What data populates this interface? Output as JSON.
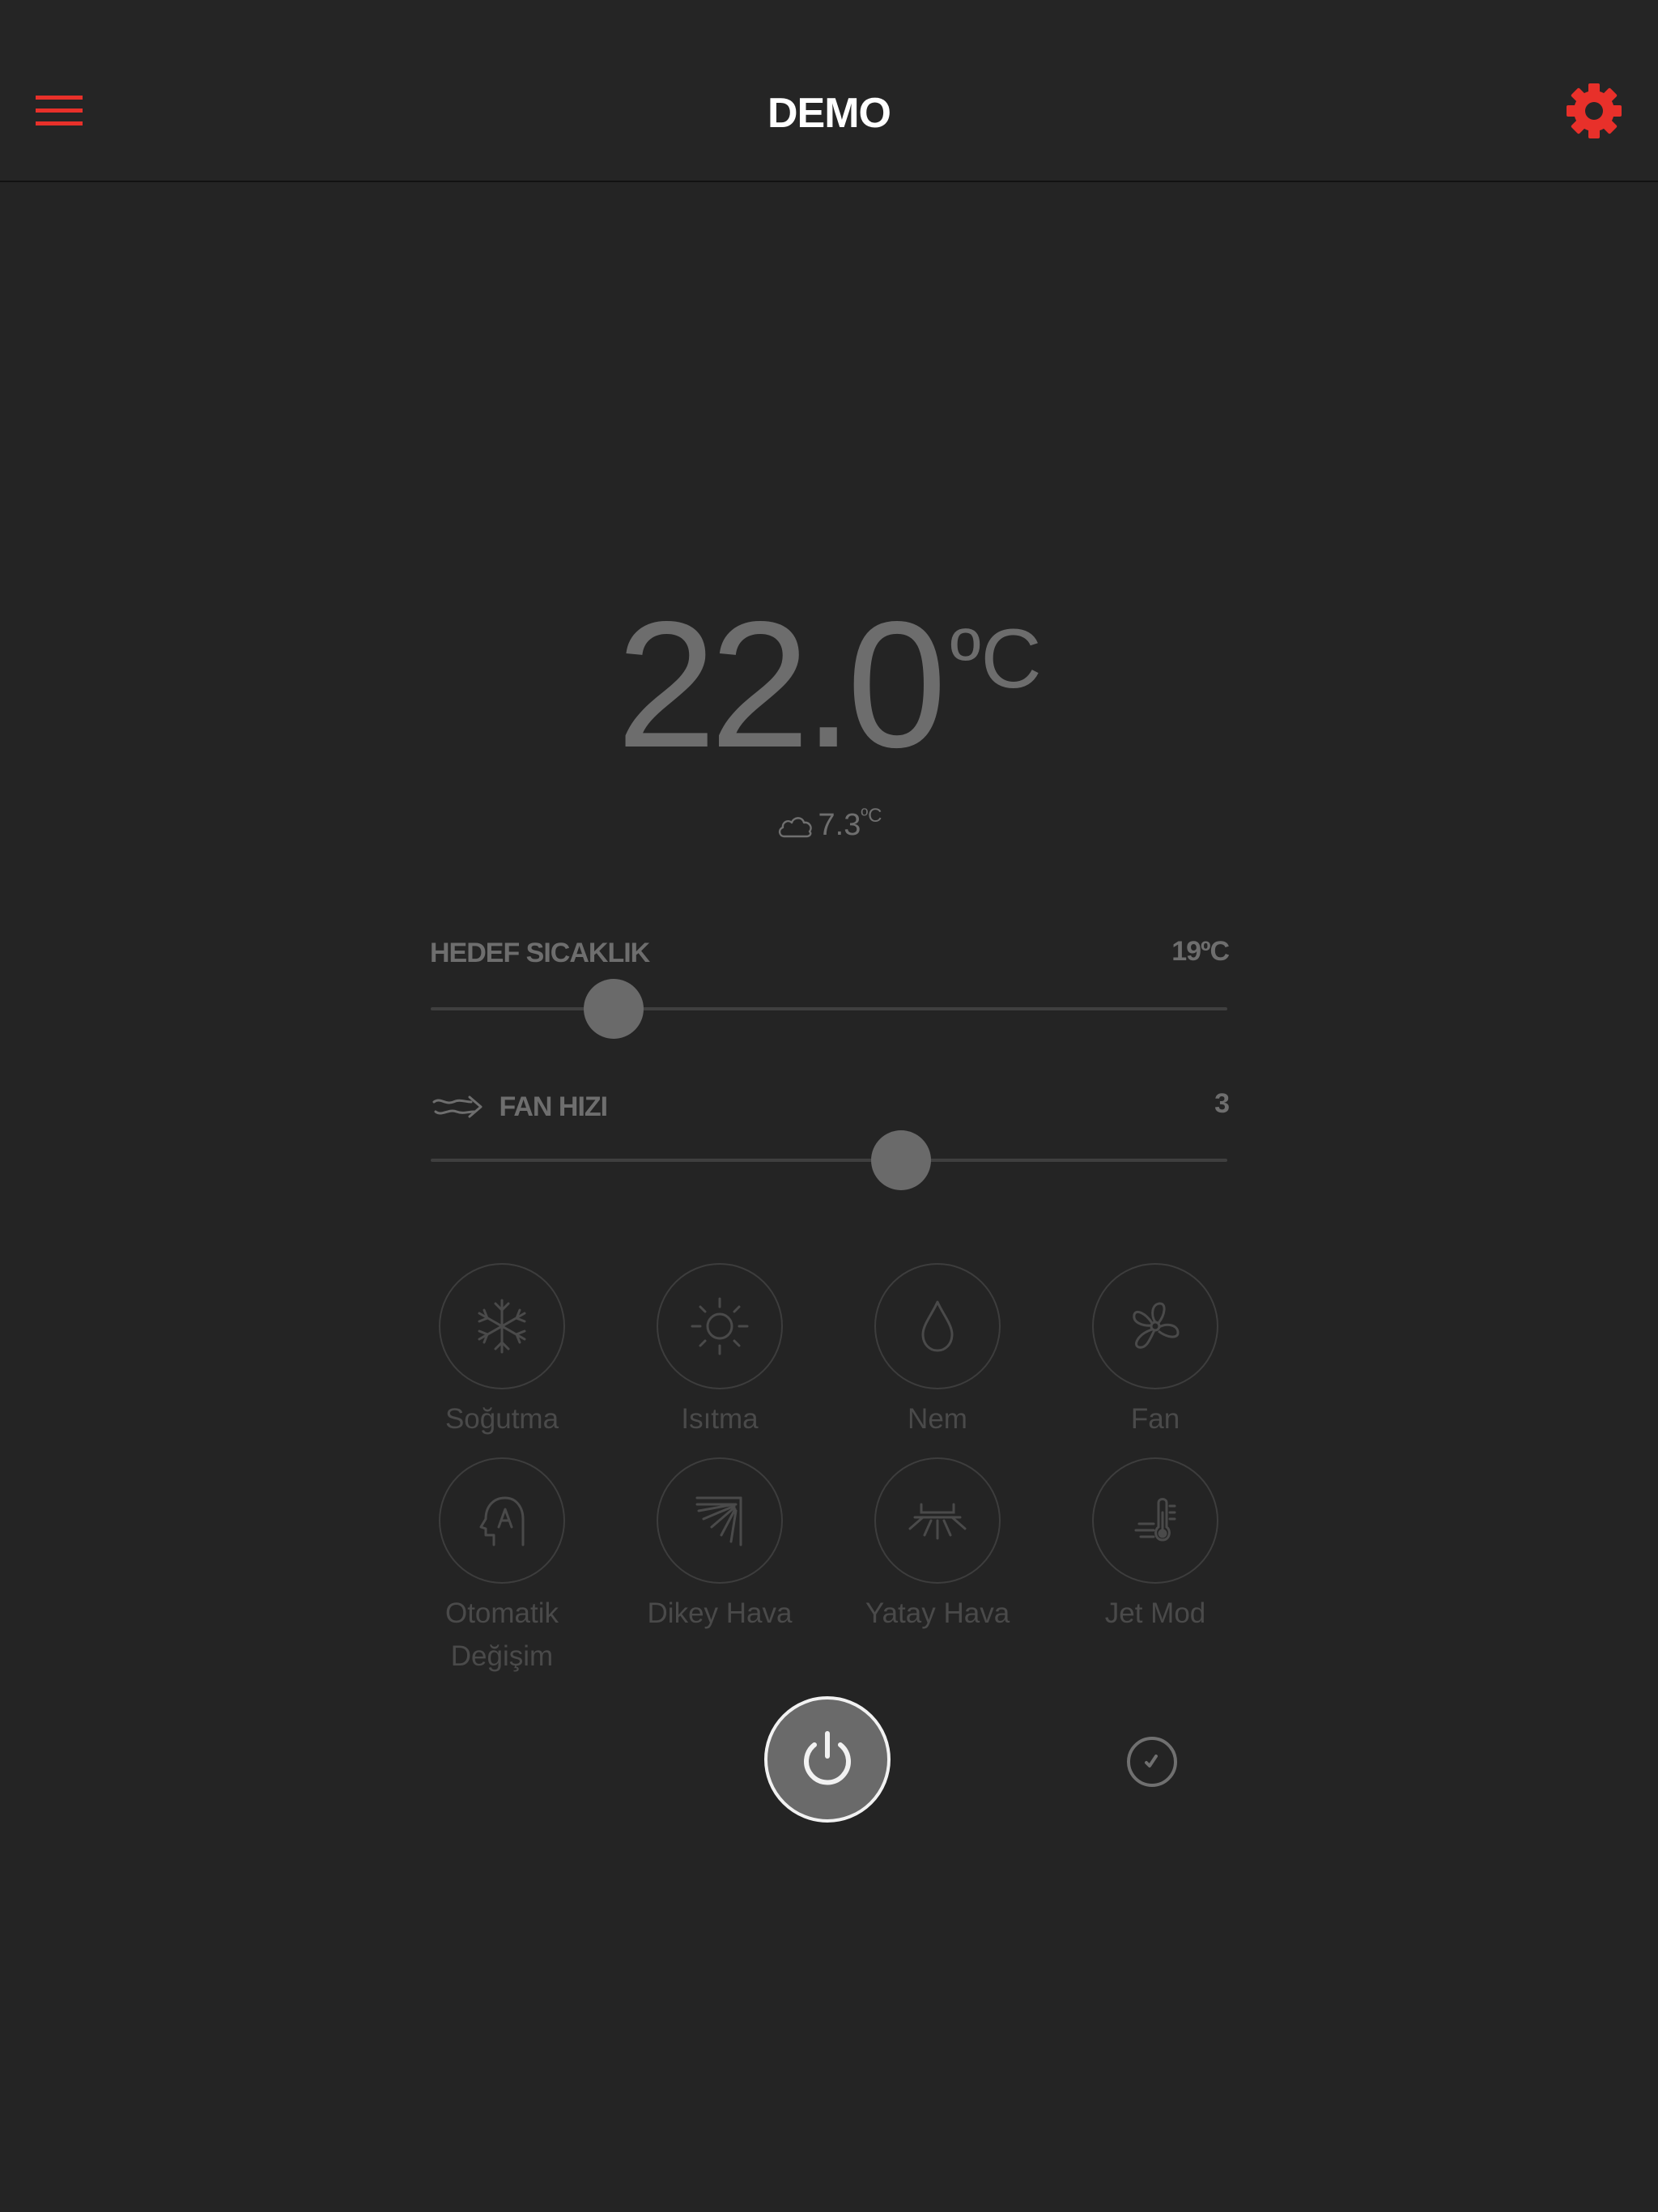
{
  "header": {
    "title": "DEMO",
    "menu_icon": "hamburger-menu-icon",
    "settings_icon": "gear-icon",
    "accent_color": "#e8302a"
  },
  "climate": {
    "room_temperature": "22.0",
    "room_temperature_unit": "ºC",
    "outdoor_icon": "cloud-icon",
    "outdoor_temperature": "7.3",
    "outdoor_temperature_unit": "ºC"
  },
  "target": {
    "label": "HEDEF SICAKLIK",
    "value_text": "19ºC",
    "slider_fraction": 0.23
  },
  "fan": {
    "icon": "wind-icon",
    "label": "FAN HIZI",
    "value_text": "3",
    "slider_fraction": 0.59
  },
  "modes": [
    {
      "label": "Soğutma",
      "icon": "snowflake-icon"
    },
    {
      "label": "Isıtma",
      "icon": "sun-icon"
    },
    {
      "label": "Nem",
      "icon": "water-drop-icon"
    },
    {
      "label": "Fan",
      "icon": "fan-icon"
    },
    {
      "label": "Otomatik Değişim",
      "icon": "auto-head-icon"
    },
    {
      "label": "Dikey Hava",
      "icon": "vertical-swing-icon"
    },
    {
      "label": "Yatay Hava",
      "icon": "horizontal-swing-icon"
    },
    {
      "label": "Jet Mod",
      "icon": "jet-thermometer-icon"
    }
  ],
  "controls": {
    "power_icon": "power-icon",
    "timer_icon": "timer-icon"
  }
}
